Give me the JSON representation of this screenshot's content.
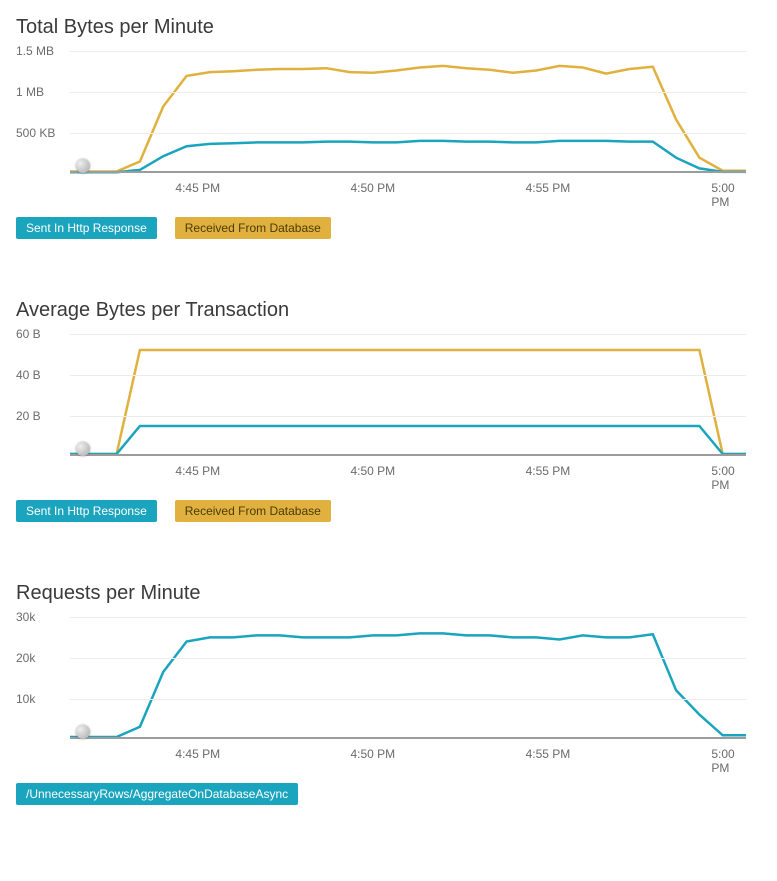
{
  "chart_data": [
    {
      "type": "line",
      "title": "Total Bytes per Minute",
      "xlabel": "",
      "ylabel": "",
      "x_ticks": [
        "4:45 PM",
        "4:50 PM",
        "4:55 PM",
        "5:00 PM"
      ],
      "y_ticks": [
        "500 KB",
        "1 MB",
        "1.5 MB"
      ],
      "y_unit": "bytes",
      "ylim": [
        0,
        1700000
      ],
      "series": [
        {
          "name": "Sent In Http Response",
          "color": "#1aa4bd",
          "values": [
            10000,
            10000,
            10000,
            40000,
            220000,
            350000,
            380000,
            390000,
            400000,
            400000,
            400000,
            410000,
            410000,
            400000,
            400000,
            420000,
            420000,
            410000,
            410000,
            400000,
            400000,
            420000,
            420000,
            420000,
            410000,
            410000,
            200000,
            60000,
            15000,
            15000
          ]
        },
        {
          "name": "Received From Database",
          "color": "#e0b13e",
          "values": [
            20000,
            20000,
            20000,
            150000,
            870000,
            1270000,
            1320000,
            1330000,
            1350000,
            1360000,
            1360000,
            1370000,
            1320000,
            1310000,
            1340000,
            1380000,
            1400000,
            1370000,
            1350000,
            1310000,
            1340000,
            1400000,
            1380000,
            1300000,
            1360000,
            1390000,
            700000,
            200000,
            30000,
            30000
          ]
        }
      ],
      "legend": [
        "Sent In Http Response",
        "Received From Database"
      ]
    },
    {
      "type": "line",
      "title": "Average Bytes per Transaction",
      "xlabel": "",
      "ylabel": "",
      "x_ticks": [
        "4:45 PM",
        "4:50 PM",
        "4:55 PM",
        "5:00 PM"
      ],
      "y_ticks": [
        "20 B",
        "40 B",
        "60 B"
      ],
      "y_unit": "bytes",
      "ylim": [
        0,
        65
      ],
      "series": [
        {
          "name": "Sent In Http Response",
          "color": "#1aa4bd",
          "values": [
            1,
            1,
            1,
            15,
            15,
            15,
            15,
            15,
            15,
            15,
            15,
            15,
            15,
            15,
            15,
            15,
            15,
            15,
            15,
            15,
            15,
            15,
            15,
            15,
            15,
            15,
            15,
            15,
            1,
            1
          ]
        },
        {
          "name": "Received From Database",
          "color": "#e0b13e",
          "values": [
            1,
            1,
            1,
            53,
            53,
            53,
            53,
            53,
            53,
            53,
            53,
            53,
            53,
            53,
            53,
            53,
            53,
            53,
            53,
            53,
            53,
            53,
            53,
            53,
            53,
            53,
            53,
            53,
            1,
            1
          ]
        }
      ],
      "legend": [
        "Sent In Http Response",
        "Received From Database"
      ]
    },
    {
      "type": "line",
      "title": "Requests per Minute",
      "xlabel": "",
      "ylabel": "",
      "x_ticks": [
        "4:45 PM",
        "4:50 PM",
        "4:55 PM",
        "5:00 PM"
      ],
      "y_ticks": [
        "10k",
        "20k",
        "30k"
      ],
      "y_unit": "count",
      "ylim": [
        0,
        32000
      ],
      "series": [
        {
          "name": "/UnnecessaryRows/AggregateOnDatabaseAsync",
          "color": "#1aa4bd",
          "values": [
            500,
            500,
            500,
            3000,
            16500,
            24000,
            25000,
            25000,
            25500,
            25500,
            25000,
            25000,
            25000,
            25500,
            25500,
            26000,
            26000,
            25500,
            25500,
            25000,
            25000,
            24500,
            25500,
            25000,
            25000,
            25800,
            12000,
            6000,
            900,
            900
          ]
        }
      ],
      "legend": [
        "/UnnecessaryRows/AggregateOnDatabaseAsync"
      ]
    }
  ]
}
